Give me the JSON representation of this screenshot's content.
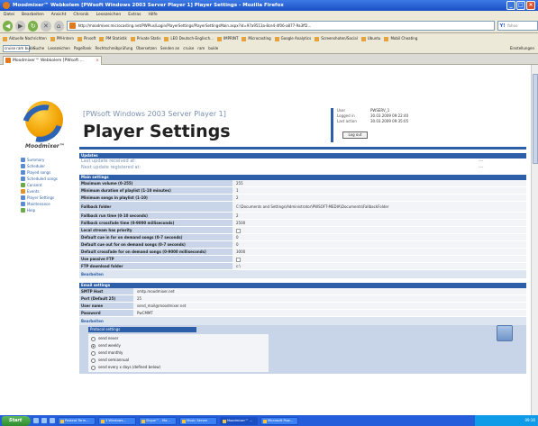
{
  "window": {
    "title": "Moodmixer™ Webkolem [PWsoft Windows 2003 Server Player 1] Player Settings - Mozilla Firefox"
  },
  "menu": [
    "Datei",
    "Bearbeiten",
    "Ansicht",
    "Chronik",
    "Lesezeichen",
    "Extras",
    "Hilfe"
  ],
  "navbar": {
    "url": "http://moodmixer.microcasting.net/PWPlus/Login/PlayerSettings/PlayerSettingsMain.aspx?id=97a9513a-8ce4-4f06-a877-9a3ff2...",
    "search_placeholder": "Yahoo"
  },
  "bookmarks": [
    "Aktuelle Nachrichten",
    "PM-Intern",
    "Pinsoft",
    "PM Statistik",
    "Private Statis",
    "LEO Deutsch-Englisch...",
    "IMPRINT",
    "Microcasting",
    "Google Analytics",
    "Screenshoten/Social",
    "Ubuntu",
    "Mobil Cheating"
  ],
  "toolbar2": {
    "input_value": "cruise ram bukle",
    "items": [
      "Suche",
      "Lesezeichen",
      "PageRank",
      "Rechtschreibprüfung",
      "Übersetzen",
      "Senden an",
      "cruise",
      "ram",
      "bukle"
    ],
    "right_label": "Einstellungen"
  },
  "tab": {
    "label": "Moodmixer™ Webkolem [PWsoft ..."
  },
  "page": {
    "logo_word": "Moodmixer™",
    "subtitle": "[PWsoft Windows 2003 Server Player 1]",
    "title": "Player Settings",
    "info": {
      "rows": [
        {
          "label": "User",
          "value": "PWSERV_1"
        },
        {
          "label": "Logged in",
          "value": "30.03.2009 09:22:40"
        },
        {
          "label": "Last action",
          "value": "30.03.2009 09:35:05"
        }
      ],
      "logout_label": "Log out"
    }
  },
  "sidenav": [
    {
      "label": "Summary",
      "icon": "summary-icon",
      "color": "#5b8bd0"
    },
    {
      "label": "Scheduler",
      "icon": "scheduler-icon",
      "color": "#5b8bd0"
    },
    {
      "label": "Played songs",
      "icon": "songs-icon",
      "color": "#5b8bd0"
    },
    {
      "label": "Scheduled songs",
      "icon": "scheduled-icon",
      "color": "#5b8bd0"
    },
    {
      "label": "Consent",
      "icon": "consent-icon",
      "color": "#6aaa4a"
    },
    {
      "label": "Events",
      "icon": "events-icon",
      "color": "#e2922a"
    },
    {
      "label": "Player Settings",
      "icon": "settings-icon",
      "color": "#5b8bd0"
    },
    {
      "label": "Maintenance",
      "icon": "maintenance-icon",
      "color": "#5b8bd0"
    },
    {
      "label": "Help",
      "icon": "help-icon",
      "color": "#6aaa4a"
    }
  ],
  "updates": {
    "header": "Updates",
    "rows": [
      {
        "text": "Last update received at:",
        "value": "---"
      },
      {
        "text": "Next update registered at:",
        "value": "---"
      }
    ]
  },
  "main_settings": {
    "header": "Main settings",
    "rows": [
      {
        "label": "Maximum volume (0-255)",
        "value": "255",
        "type": "text"
      },
      {
        "label": "Minimum duration of playlist (1-10 minutes)",
        "value": "1",
        "type": "text"
      },
      {
        "label": "Minimum songs in playlist (1-10)",
        "value": "2",
        "type": "text"
      },
      {
        "label": "Fallback folder",
        "value": "C:\\Documents and Settings\\Administrator\\PWSOFT-MEDIA\\Documents\\FallbackFolder",
        "type": "text",
        "tall": true
      },
      {
        "label": "Fallback run time (0-10 seconds)",
        "value": "2",
        "type": "text"
      },
      {
        "label": "Fallback crossfade time (0-9000 milliseconds)",
        "value": "2500",
        "type": "text"
      },
      {
        "label": "Local stream has priority",
        "value": "",
        "type": "checkbox"
      },
      {
        "label": "Default cue in for on demand songs (0-7 seconds)",
        "value": "0",
        "type": "text"
      },
      {
        "label": "Default cue out for on demand songs (0-7 seconds)",
        "value": "0",
        "type": "text"
      },
      {
        "label": "Default crossfade for on demand songs (0-9000 milliseconds)",
        "value": "3000",
        "type": "text"
      },
      {
        "label": "Use passive FTP",
        "value": "",
        "type": "checkbox"
      },
      {
        "label": "FTP download folder",
        "value": "c:\\",
        "type": "text"
      }
    ],
    "edit_label": "Bearbeiten"
  },
  "email_settings": {
    "header": "Email settings",
    "rows": [
      {
        "label": "SMTP Host",
        "value": "smtp.moodmixer.net"
      },
      {
        "label": "Port (Default 25)",
        "value": "25"
      },
      {
        "label": "User name",
        "value": "send_mail@moodmixer.net"
      },
      {
        "label": "Password",
        "value": "PwCMMT"
      }
    ],
    "edit_label": "Bearbeiten"
  },
  "protocol": {
    "header": "Protocol settings",
    "options": [
      {
        "label": "send never",
        "selected": false
      },
      {
        "label": "send weekly",
        "selected": true
      },
      {
        "label": "send monthly",
        "selected": false
      },
      {
        "label": "send semiannual",
        "selected": false
      },
      {
        "label": "send every x days (defined below)",
        "selected": false
      }
    ]
  },
  "taskbar": {
    "start_label": "Start",
    "buttons": [
      "Posteot Term...",
      "3 Windows...",
      "Skype™ - Ma...",
      "Music Server",
      "Moodmixer™ ...",
      "Microsoft Pow..."
    ],
    "clock": "09:36"
  }
}
